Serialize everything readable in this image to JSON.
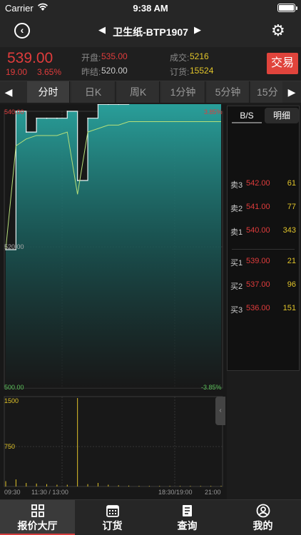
{
  "status_bar": {
    "carrier": "Carrier",
    "time": "9:38 AM"
  },
  "nav": {
    "title": "卫生纸-BTP1907"
  },
  "quote": {
    "last_price": "539.00",
    "change": "19.00",
    "change_pct": "3.65%",
    "open_label": "开盘:",
    "open_value": "535.00",
    "prev_close_label": "昨结:",
    "prev_close_value": "520.00",
    "volume_label": "成交:",
    "volume_value": "5216",
    "orders_label": "订货:",
    "orders_value": "15524",
    "trade_button": "交易"
  },
  "tabs": [
    "分时",
    "日K",
    "周K",
    "1分钟",
    "5分钟",
    "15分"
  ],
  "active_tab": 0,
  "chart": {
    "price_top": "540.00",
    "price_mid": "520.00",
    "price_bottom": "500.00",
    "pct_top": "3.85%",
    "pct_bottom": "-3.85%",
    "vol_top": "1500",
    "vol_mid": "750",
    "time_labels": [
      "09:30",
      "11:30 / 13:00",
      "18:30/19:00",
      "21:00"
    ]
  },
  "chart_data": {
    "type": "line",
    "title": "",
    "xlabel": "",
    "ylabel": "",
    "ylim": [
      500,
      540
    ],
    "series": [
      {
        "values": [
          520,
          535,
          536,
          536.5,
          536.5,
          536.5,
          537,
          528,
          537,
          537.5,
          538,
          538,
          538.5,
          538.5,
          538.5,
          538.5,
          538.5,
          538.5,
          538.5,
          538.5,
          538.5,
          538.5
        ]
      },
      {
        "values": [
          520,
          540,
          537,
          539,
          539,
          539,
          540,
          530,
          539,
          541,
          541,
          541,
          542,
          542,
          542,
          542,
          542,
          542,
          542,
          542,
          542,
          542
        ]
      }
    ],
    "volume": {
      "ylim": [
        0,
        1500
      ],
      "values": [
        90,
        120,
        60,
        50,
        40,
        30,
        30,
        1500,
        40,
        60,
        30,
        20,
        15,
        10,
        10,
        10,
        10,
        10,
        10,
        10,
        10,
        10
      ]
    }
  },
  "order_book": {
    "tab_bs": "B/S",
    "tab_detail": "明细",
    "asks": [
      {
        "label": "卖3",
        "price": "542.00",
        "qty": "61"
      },
      {
        "label": "卖2",
        "price": "541.00",
        "qty": "77"
      },
      {
        "label": "卖1",
        "price": "540.00",
        "qty": "343"
      }
    ],
    "bids": [
      {
        "label": "买1",
        "price": "539.00",
        "qty": "21"
      },
      {
        "label": "买2",
        "price": "537.00",
        "qty": "96"
      },
      {
        "label": "买3",
        "price": "536.00",
        "qty": "151"
      }
    ]
  },
  "bottom_nav": [
    "报价大厅",
    "订货",
    "查询",
    "我的"
  ],
  "icons": {
    "back": "back-icon",
    "settings": "gear-icon",
    "trade": "trade-icon"
  },
  "colors": {
    "up": "#e03c3c",
    "accent": "#e2c52a",
    "teal": "#2aa39e"
  }
}
